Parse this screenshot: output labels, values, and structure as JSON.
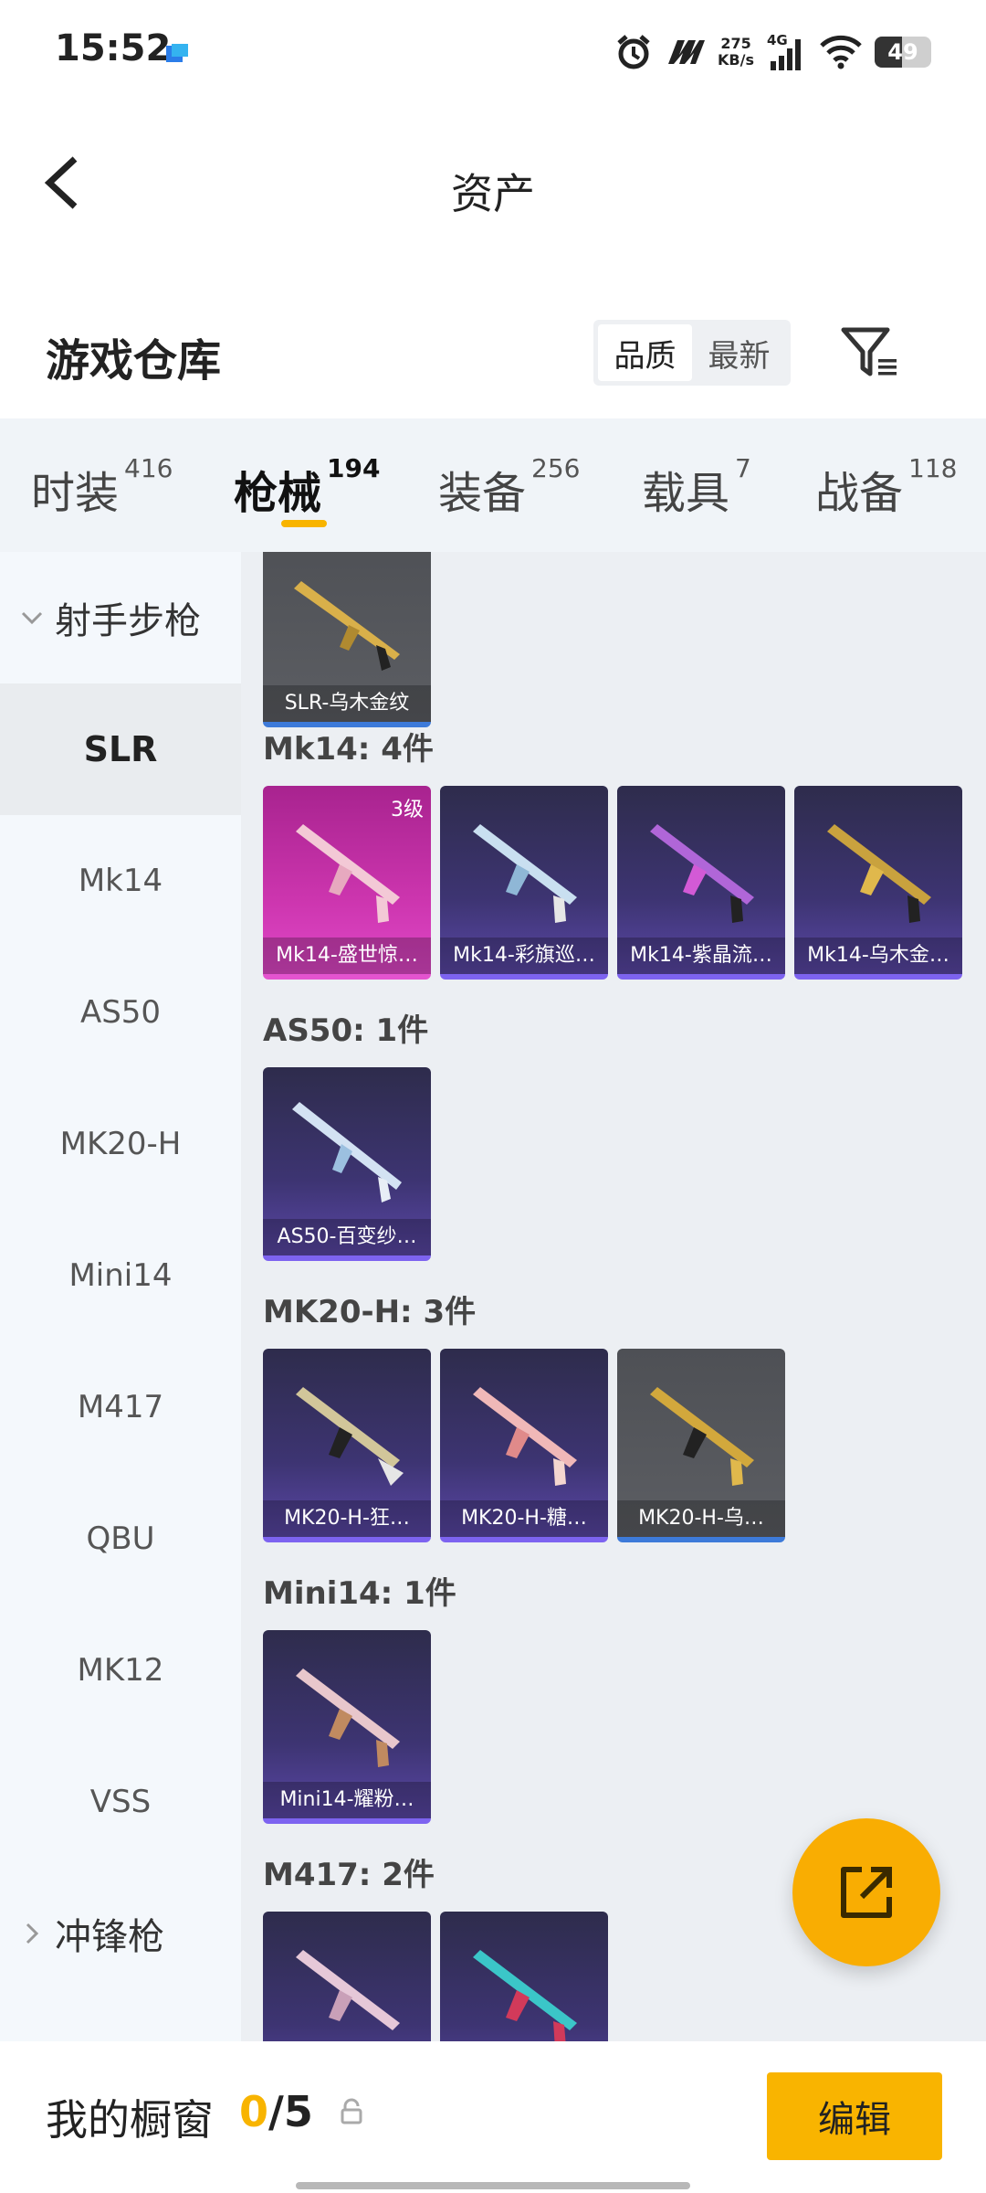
{
  "status_bar": {
    "time": "15:52",
    "speed_value": "275",
    "speed_unit": "KB/s",
    "network": "4G",
    "battery": "49"
  },
  "header": {
    "title": "资产"
  },
  "warehouse": {
    "title": "游戏仓库",
    "sort_quality": "品质",
    "sort_newest": "最新"
  },
  "tabs": [
    {
      "label": "时装",
      "count": "416"
    },
    {
      "label": "枪械",
      "count": "194"
    },
    {
      "label": "装备",
      "count": "256"
    },
    {
      "label": "载具",
      "count": "7"
    },
    {
      "label": "战备",
      "count": "118"
    }
  ],
  "sidebar": {
    "group_dmr": "射手步枪",
    "items": [
      "SLR",
      "Mk14",
      "AS50",
      "MK20-H",
      "Mini14",
      "M417",
      "QBU",
      "MK12",
      "VSS"
    ],
    "group_smg": "冲锋枪"
  },
  "content": {
    "slr_cards": [
      "SLR-乌木金纹"
    ],
    "groups": [
      {
        "title": "Mk14: 4件",
        "cards": [
          "Mk14-盛世惊…",
          "Mk14-彩旗巡…",
          "Mk14-紫晶流…",
          "Mk14-乌木金…"
        ],
        "first_level": "3级"
      },
      {
        "title": "AS50: 1件",
        "cards": [
          "AS50-百变纱…"
        ]
      },
      {
        "title": "MK20-H: 3件",
        "cards": [
          "MK20-H-狂…",
          "MK20-H-糖…",
          "MK20-H-乌…"
        ]
      },
      {
        "title": "Mini14: 1件",
        "cards": [
          "Mini14-耀粉…"
        ]
      },
      {
        "title": "M417: 2件",
        "cards": [
          "",
          ""
        ]
      }
    ]
  },
  "bottom": {
    "showcase_label": "我的橱窗",
    "showcase_current": "0",
    "showcase_total": "/5",
    "edit_label": "编辑"
  },
  "colors": {
    "accent": "#f9b400",
    "purple_card": "#3d3472",
    "pink_card": "#cc35ae",
    "gray_card": "#5c5e63"
  }
}
